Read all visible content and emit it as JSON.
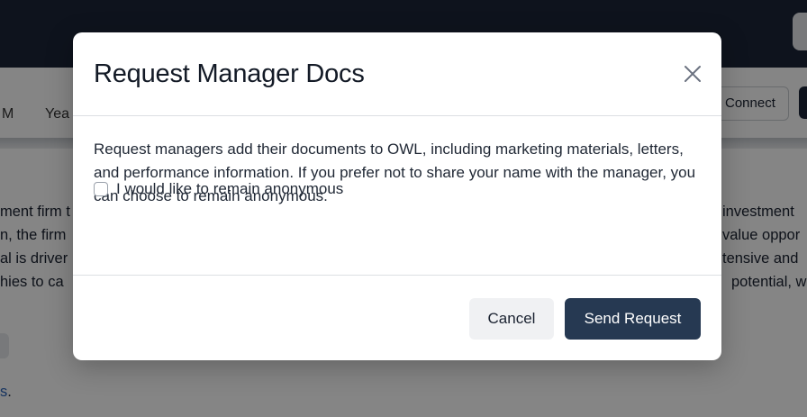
{
  "background": {
    "tabs": [
      "M",
      "Yea"
    ],
    "connect_label": "Connect",
    "text_left": [
      "ment firm t",
      "n, the firm",
      "al is driver",
      "hies to ca"
    ],
    "text_right": [
      "investment",
      "value oppor",
      "tensive and",
      "potential, w"
    ],
    "link_text": "s",
    "link_dot": "."
  },
  "modal": {
    "title": "Request Manager Docs",
    "body": "Request managers add their documents to OWL, including marketing materials, letters, and performance information. If you prefer not to share your name with the manager, you can choose to remain anonymous.",
    "anonymous_label": "I would like to remain anonymous",
    "anonymous_checked": false,
    "cancel_label": "Cancel",
    "send_label": "Send Request"
  },
  "colors": {
    "topbar": "#1b2638",
    "primary_button": "#263952",
    "link": "#2a63b8"
  }
}
